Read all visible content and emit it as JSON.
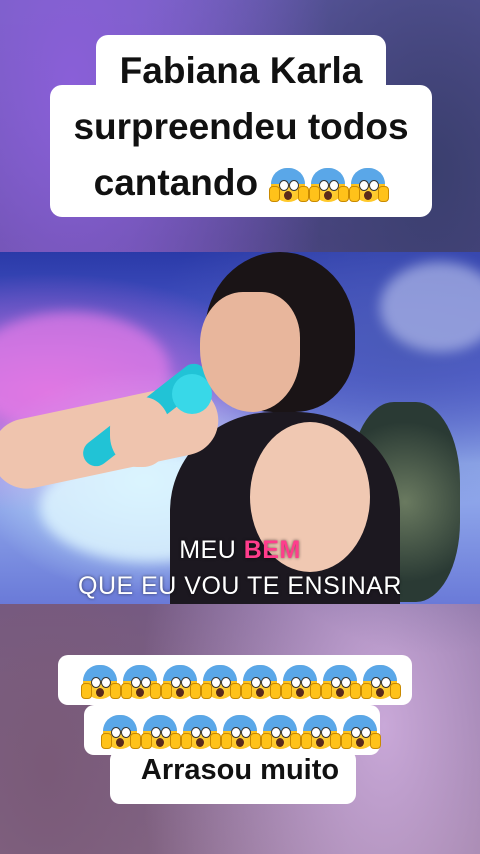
{
  "top_caption": {
    "line1": "Fabiana Karla",
    "line2": "surpreendeu todos",
    "line3": "cantando"
  },
  "video": {
    "subtitle_line1_plain": "MEU ",
    "subtitle_line1_highlight": "BEM",
    "subtitle_line2": "QUE EU VOU TE ENSINAR",
    "highlight_color": "#ff3d8c"
  },
  "reactions": {
    "emoji_name": "face-screaming-in-fear",
    "title_row_count": 3,
    "row1_count": 8,
    "row2_count": 7
  },
  "bottom_caption": "Arrasou muito"
}
